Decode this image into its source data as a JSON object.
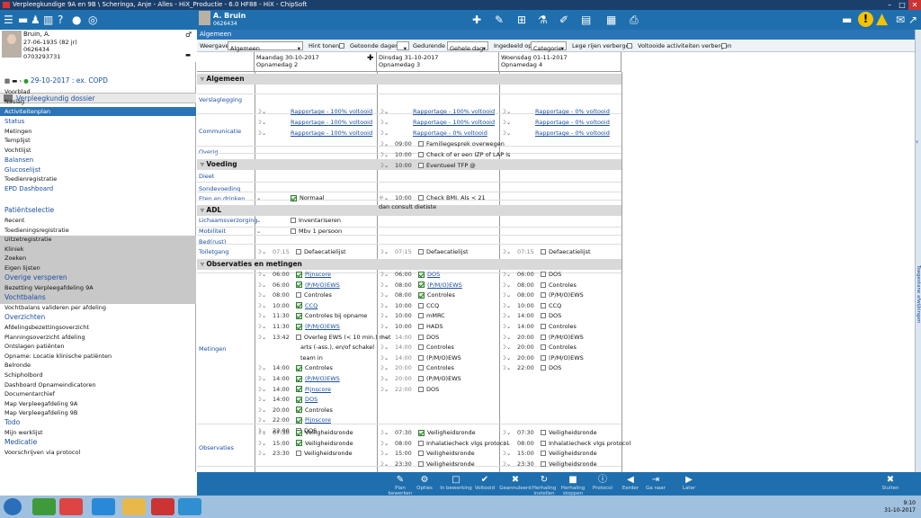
{
  "window": {
    "title": "Verpleegkundige 9A en 9B \\ Scheringa, Anje - Alles - HiX_Productie - 6.0 HF88 - HiX - ChipSoft"
  },
  "header": {
    "user_name": "A. Bruin",
    "user_id": "0626434"
  },
  "patient": {
    "name": "Bruin, A.",
    "dob": "27-06-1935 (82 jr)",
    "id": "0626434",
    "phone": "0703293731"
  },
  "left": {
    "dossier": "Verpleegkundig dossier",
    "episode": "29-10-2017 : ex. COPD",
    "nav": [
      "Voorblad",
      "Naslag",
      "Activiteitenplan",
      "Status",
      "Metingen",
      "Templijst",
      "Vochtlijst",
      "Balansen",
      "Glucoselijst",
      "Toedienregistratie",
      "EPD Dashboard"
    ],
    "patientselectie": "Patiëntselectie",
    "ps_items": [
      "Recent",
      "Toedieningsregistratie",
      "Uitzetregistratie",
      "Kliniek",
      "Zoeken",
      "Eigen lijsten"
    ],
    "overige_hdr": "Overige versperen",
    "overige_items": [
      "Bezetting Verpleegafdeling 9A"
    ],
    "vocht_hdr": "Vochtbalans",
    "vocht_items": [
      "Vochtbalans valideren per afdeling"
    ],
    "overz_hdr": "Overzichten",
    "overz_items": [
      "Afdelingsbezettingsoverzicht",
      "Planningsoverzicht afdeling",
      "Ontslagen patiënten",
      "Opname: Locatie klinische patiënten",
      "Belronde",
      "Schipholbord",
      "Dashboard Opnameindicatoren",
      "Documentarchief",
      "Map Verpleegafdeling 9A",
      "Map Verpleegafdeling 9B"
    ],
    "todo_hdr": "Todo",
    "todo_items": [
      "Mijn werklijst"
    ],
    "med_hdr": "Medicatie",
    "med_items": [
      "Voorschrijven via protocol"
    ]
  },
  "main": {
    "tab": "Algemeen",
    "filters": {
      "weergave_label": "Weergave",
      "weergave": "Algemeen",
      "hint": "Hint tonen",
      "getoonde": "Getoonde dagen",
      "gedurende": "Gedurende",
      "gehele": "Gehele dag",
      "ingedeeld": "Ingedeeld op",
      "categorie": "Categorie",
      "lege": "Lege rijen verbergen",
      "voltooide": "Voltooide activiteiten verbergen"
    },
    "days": [
      {
        "date": "Maandag 30-10-2017",
        "sub": "Opnamedag 2"
      },
      {
        "date": "Dinsdag 31-10-2017",
        "sub": "Opnamedag 3"
      },
      {
        "date": "Woensdag 01-11-2017",
        "sub": "Opnamedag 4"
      }
    ],
    "sections": {
      "algemeen": "Algemeen",
      "voeding": "Voeding",
      "adl": "ADL",
      "obs": "Observaties en metingen"
    },
    "cats": [
      "Verslaglegging",
      "Communicatie",
      "Overig",
      "Dieet",
      "Sondevoeding",
      "Eten en drinken",
      "Lichaamsverzorging",
      "Mobiliteit",
      "Bed(rust)",
      "Toiletgang",
      "Metingen",
      "Observaties"
    ],
    "rapportage": [
      "Rapportage - 100% voltooid",
      "Rapportage - 0% voltooid"
    ],
    "comm": [
      {
        "t": "09:00",
        "l": "Familiegesprek overwegen"
      },
      {
        "t": "10:00",
        "l": "Check of er een IZP of LAP is"
      },
      {
        "t": "10:00",
        "l": "Eventueel TFP @"
      }
    ],
    "dieet": "Normaal",
    "bmi": "Check BMI. Als < 21 dan consult dietiste",
    "bmi_t": "10:00",
    "adl": [
      "Inventariseren",
      "Mbv 1 persoon",
      "Defaecatielijst"
    ],
    "tg_time": "07:15",
    "met1": [
      {
        "t": "06:00",
        "l": "Pijnscore",
        "c": 1,
        "k": 1
      },
      {
        "t": "06:00",
        "l": "(P/M/O)EWS",
        "c": 1,
        "k": 1
      },
      {
        "t": "08:00",
        "l": "Controles",
        "c": 0,
        "k": 0
      },
      {
        "t": "10:00",
        "l": "CCQ",
        "c": 1,
        "k": 1
      },
      {
        "t": "11:30",
        "l": "Controles bij opname",
        "c": 1,
        "k": 0
      },
      {
        "t": "11:30",
        "l": "(P/M/O)EWS",
        "c": 1,
        "k": 1
      },
      {
        "t": "13:42",
        "l": "Overleg EWS (< 10 min.) met",
        "c": 0,
        "k": 0
      },
      {
        "t": "",
        "l": "arts (-ass.), en/of schakel",
        "c": -1,
        "k": 0
      },
      {
        "t": "",
        "l": "team in",
        "c": -1,
        "k": 0
      },
      {
        "t": "14:00",
        "l": "Controles",
        "c": 1,
        "k": 0
      },
      {
        "t": "14:00",
        "l": "(P/M/O)EWS",
        "c": 1,
        "k": 1
      },
      {
        "t": "14:00",
        "l": "Pijnscore",
        "c": 1,
        "k": 1
      },
      {
        "t": "14:00",
        "l": "DOS",
        "c": 1,
        "k": 1
      },
      {
        "t": "20:00",
        "l": "Controles",
        "c": 1,
        "k": 0
      },
      {
        "t": "22:00",
        "l": "Pijnscore",
        "c": 1,
        "k": 1
      },
      {
        "t": "22:00",
        "l": "DOS",
        "c": 0,
        "k": 0
      }
    ],
    "met2": [
      {
        "t": "06:00",
        "l": "DOS",
        "c": 1,
        "k": 1
      },
      {
        "t": "08:00",
        "l": "(P/M/O)EWS",
        "c": 1,
        "k": 1
      },
      {
        "t": "08:00",
        "l": "Controles",
        "c": 1,
        "k": 0
      },
      {
        "t": "10:00",
        "l": "CCQ",
        "c": 0,
        "k": 0
      },
      {
        "t": "10:00",
        "l": "mMRC",
        "c": 0,
        "k": 0
      },
      {
        "t": "10:00",
        "l": "HADS",
        "c": 0,
        "k": 0
      },
      {
        "t": "14:00",
        "l": "DOS",
        "c": 0,
        "k": 0
      },
      {
        "t": "14:00",
        "l": "Controles",
        "c": 0,
        "k": 0
      },
      {
        "t": "14:00",
        "l": "(P/M/O)EWS",
        "c": 0,
        "k": 0
      },
      {
        "t": "20:00",
        "l": "Controles",
        "c": 0,
        "k": 0
      },
      {
        "t": "20:00",
        "l": "(P/M/O)EWS",
        "c": 0,
        "k": 0
      },
      {
        "t": "22:00",
        "l": "DOS",
        "c": 0,
        "k": 0
      }
    ],
    "met3": [
      {
        "t": "06:00",
        "l": "DOS"
      },
      {
        "t": "08:00",
        "l": "Controles"
      },
      {
        "t": "08:00",
        "l": "(P/M/O)EWS"
      },
      {
        "t": "10:00",
        "l": "CCQ"
      },
      {
        "t": "14:00",
        "l": "DOS"
      },
      {
        "t": "14:00",
        "l": "Controles"
      },
      {
        "t": "20:00",
        "l": "(P/M/O)EWS"
      },
      {
        "t": "20:00",
        "l": "Controles"
      },
      {
        "t": "20:00",
        "l": "(P/M/O)EWS"
      },
      {
        "t": "22:00",
        "l": "DOS"
      }
    ],
    "obs1": [
      {
        "t": "07:30",
        "l": "Veiligheidsronde",
        "c": 1
      },
      {
        "t": "15:00",
        "l": "Veiligheidsronde",
        "c": 1
      },
      {
        "t": "23:30",
        "l": "Veiligheidsronde",
        "c": 0
      }
    ],
    "obs2": [
      {
        "t": "07:30",
        "l": "Veiligheidsronde",
        "c": 1
      },
      {
        "t": "08:00",
        "l": "Inhalatiecheck vlgs protocol",
        "c": 0
      },
      {
        "t": "15:00",
        "l": "Veiligheidsronde",
        "c": 0
      },
      {
        "t": "23:30",
        "l": "Veiligheidsronde",
        "c": 0
      }
    ],
    "obs3": [
      {
        "t": "07:30",
        "l": "Veiligheidsronde"
      },
      {
        "t": "08:00",
        "l": "Inhalatiecheck vlgs protocol"
      },
      {
        "t": "15:00",
        "l": "Veiligheidsronde"
      },
      {
        "t": "23:30",
        "l": "Veiligheidsronde"
      }
    ]
  },
  "right_tab": "Toegestane afwijkingen",
  "bottom": [
    "Plan bewerken",
    "Opties",
    "In bewerking",
    "Voltooid",
    "Geannuleerd",
    "Herhaling instellen",
    "Herhaling stoppen",
    "Protocol",
    "Eerder",
    "Ga naar",
    "Later",
    "Sluiten"
  ],
  "taskbar": {
    "time": "9:10",
    "date": "31-10-2017"
  }
}
